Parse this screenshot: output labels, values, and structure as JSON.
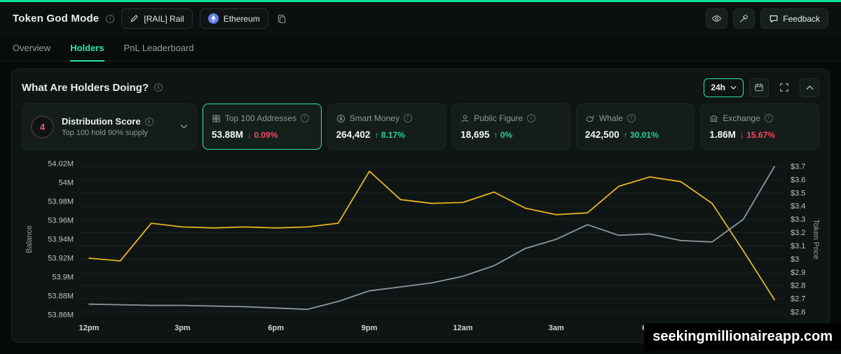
{
  "header": {
    "title": "Token God Mode",
    "token_pair": "[RAIL] Rail",
    "network": "Ethereum",
    "feedback": "Feedback"
  },
  "tabs": [
    {
      "label": "Overview",
      "active": false
    },
    {
      "label": "Holders",
      "active": true
    },
    {
      "label": "PnL Leaderboard",
      "active": false
    }
  ],
  "panel": {
    "title": "What Are Holders Doing?",
    "timeframe": "24h"
  },
  "cards": [
    {
      "badge": "4",
      "title": "Distribution Score",
      "subtitle": "Top 100 hold 90% supply"
    },
    {
      "title": "Top 100 Addresses",
      "value": "53.88M",
      "arrow": "↓",
      "change": "0.09%",
      "direction": "down",
      "selected": true
    },
    {
      "title": "Smart Money",
      "value": "264,402",
      "arrow": "↑",
      "change": "8.17%",
      "direction": "up"
    },
    {
      "title": "Public Figure",
      "value": "18,695",
      "arrow": "↑",
      "change": "0%",
      "direction": "up"
    },
    {
      "title": "Whale",
      "value": "242,500",
      "arrow": "↑",
      "change": "30.01%",
      "direction": "up"
    },
    {
      "title": "Exchange",
      "value": "1.86M",
      "arrow": "↓",
      "change": "15.67%",
      "direction": "down"
    }
  ],
  "icons": {
    "info": "circled-i",
    "edit": "pencil",
    "network": "ethereum-logo",
    "copy": "clipboard",
    "watch": "eye",
    "pin": "pushpin",
    "feedback": "chat-bubble",
    "timeframe_chevron": "chevron-down",
    "calendar": "calendar",
    "fullscreen": "expand",
    "collapse": "chevron-up",
    "top100": "grid",
    "smart_money": "dollar-circle",
    "public_figure": "person",
    "whale": "whale",
    "exchange": "bank"
  },
  "colors": {
    "accent_green": "#2be3a9",
    "up_green": "#1ed49c",
    "down_red": "#f6465d",
    "balance_line": "#e6b422",
    "price_line": "#8c979d",
    "top_strip": "#00e49a"
  },
  "watermark": "seekingmillionaireapp.com",
  "chart_data": {
    "type": "line",
    "title": "What Are Holders Doing?",
    "x_labels": [
      "12pm",
      "3pm",
      "6pm",
      "9pm",
      "12am",
      "3am",
      "6am"
    ],
    "x_tick_indices": [
      0,
      3,
      6,
      9,
      12,
      15,
      18
    ],
    "grid": true,
    "legend": "none",
    "left_axis": {
      "title": "Balance",
      "min": 53.86,
      "max": 54.02,
      "ticks": [
        54.02,
        54.0,
        53.98,
        53.96,
        53.94,
        53.92,
        53.9,
        53.88,
        53.86
      ],
      "labels": [
        "54.02M",
        "54M",
        "53.98M",
        "53.96M",
        "53.94M",
        "53.92M",
        "53.9M",
        "53.88M",
        "53.86M"
      ]
    },
    "right_axis": {
      "title": "Token Price",
      "min": 2.6,
      "max": 3.7,
      "ticks": [
        3.7,
        3.6,
        3.5,
        3.4,
        3.3,
        3.2,
        3.1,
        3.0,
        2.9,
        2.8,
        2.7,
        2.6
      ],
      "labels": [
        "$3.7",
        "$3.6",
        "$3.5",
        "$3.4",
        "$3.3",
        "$3.2",
        "$3.1",
        "$3",
        "$2.9",
        "$2.8",
        "$2.7",
        "$2.6"
      ]
    },
    "series": [
      {
        "name": "Balance",
        "axis": "left",
        "color": "#e6b422",
        "values": [
          53.92,
          53.917,
          53.957,
          53.953,
          53.952,
          53.953,
          53.952,
          53.953,
          53.957,
          54.012,
          53.982,
          53.978,
          53.979,
          53.99,
          53.973,
          53.966,
          53.968,
          53.996,
          54.006,
          54.001,
          53.978,
          53.928,
          53.876
        ]
      },
      {
        "name": "Token Price",
        "axis": "right",
        "color": "#8c979d",
        "values": [
          2.66,
          2.655,
          2.65,
          2.65,
          2.645,
          2.64,
          2.63,
          2.62,
          2.68,
          2.76,
          2.79,
          2.82,
          2.87,
          2.95,
          3.08,
          3.15,
          3.26,
          3.18,
          3.19,
          3.14,
          3.13,
          3.3,
          3.7
        ]
      }
    ]
  }
}
